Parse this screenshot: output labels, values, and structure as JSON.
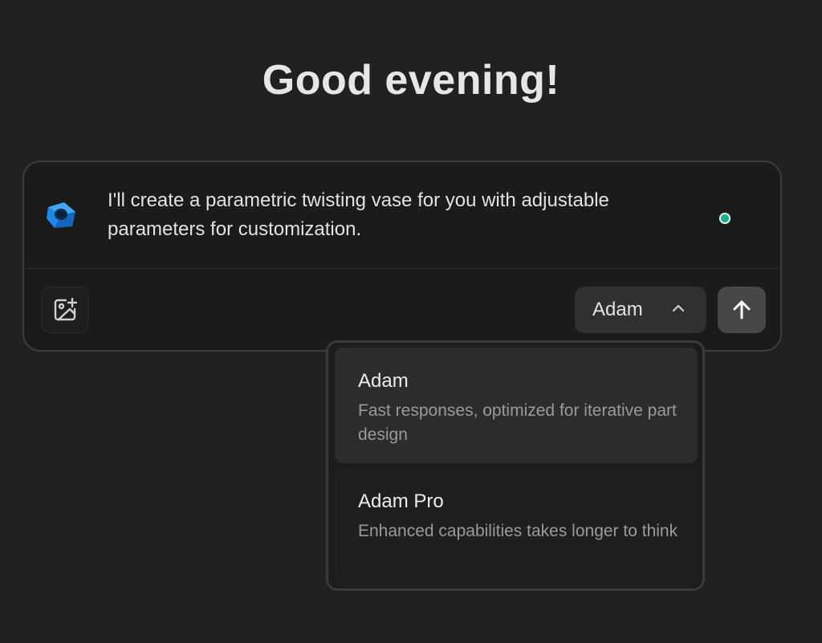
{
  "greeting": "Good evening!",
  "composer": {
    "message": "I'll create a parametric twisting vase for you with adjustable parameters for customization.",
    "image_button_icon": "add-image-icon",
    "model_selector": {
      "selected": "Adam",
      "icon": "chevron-up-icon"
    },
    "send_icon": "arrow-up-icon"
  },
  "dropdown": {
    "options": [
      {
        "title": "Adam",
        "description": "Fast responses, optimized for iterative part design"
      },
      {
        "title": "Adam Pro",
        "description": "Enhanced capabilities takes longer to think"
      }
    ]
  },
  "colors": {
    "background": "#212121",
    "status_dot": "#2bb3a0",
    "logo_blue": "#1e88e5"
  }
}
